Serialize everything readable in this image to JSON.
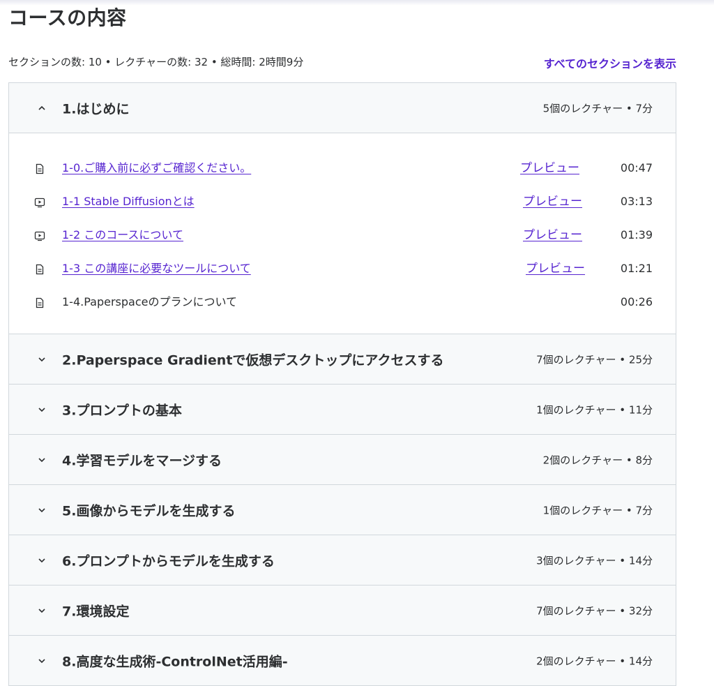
{
  "page": {
    "title": "コースの内容",
    "summary": "セクションの数: 10 • レクチャーの数: 32 • 総時間: 2時間9分",
    "expand_all_label": "すべてのセクションを表示"
  },
  "colors": {
    "accent": "#5624d0",
    "text": "#2d2f31",
    "header_bg": "#f7f9fa",
    "border": "#d1d7dc"
  },
  "sections": [
    {
      "title": "1.はじめに",
      "meta": "5個のレクチャー • 7分",
      "expanded": true,
      "lectures": [
        {
          "icon": "document-icon",
          "title": "1-0.ご購入前に必ずご確認ください。",
          "preview": "プレビュー",
          "duration": "00:47"
        },
        {
          "icon": "video-icon",
          "title": "1-1  Stable Diffusionとは",
          "preview": "プレビュー",
          "duration": "03:13"
        },
        {
          "icon": "video-icon",
          "title": "1-2  このコースについて",
          "preview": "プレビュー",
          "duration": "01:39"
        },
        {
          "icon": "document-icon",
          "title": "1-3  この講座に必要なツールについて",
          "preview": "プレビュー",
          "duration": "01:21"
        },
        {
          "icon": "document-icon",
          "title": "1-4.Paperspaceのプランについて",
          "preview": "",
          "duration": "00:26"
        }
      ]
    },
    {
      "title": "2.Paperspace Gradientで仮想デスクトップにアクセスする",
      "meta": "7個のレクチャー • 25分",
      "expanded": false
    },
    {
      "title": "3.プロンプトの基本",
      "meta": "1個のレクチャー • 11分",
      "expanded": false
    },
    {
      "title": "4.学習モデルをマージする",
      "meta": "2個のレクチャー • 8分",
      "expanded": false
    },
    {
      "title": "5.画像からモデルを生成する",
      "meta": "1個のレクチャー • 7分",
      "expanded": false
    },
    {
      "title": "6.プロンプトからモデルを生成する",
      "meta": "3個のレクチャー • 14分",
      "expanded": false
    },
    {
      "title": "7.環境設定",
      "meta": "7個のレクチャー • 32分",
      "expanded": false
    },
    {
      "title": "8.高度な生成術-ControlNet活用編-",
      "meta": "2個のレクチャー • 14分",
      "expanded": false
    }
  ]
}
